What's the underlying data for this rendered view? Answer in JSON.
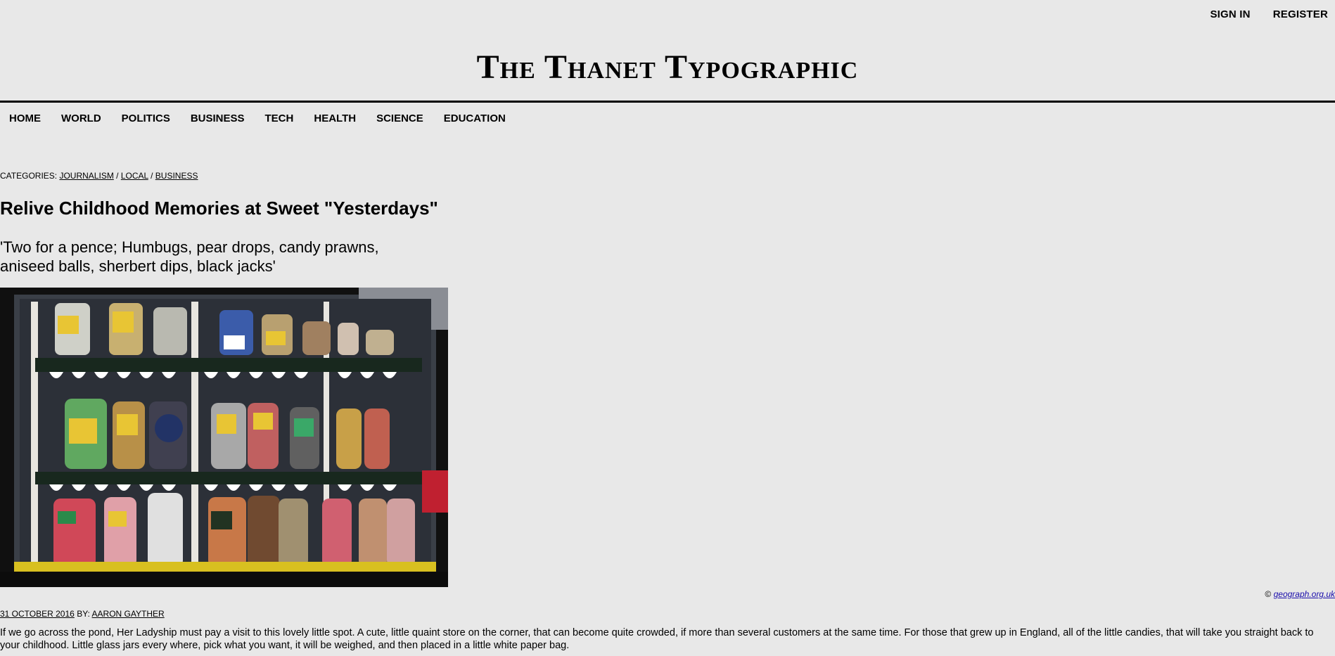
{
  "header": {
    "sign_in": "SIGN IN",
    "register": "REGISTER",
    "masthead": "The Thanet Typographic"
  },
  "nav": {
    "items": [
      "HOME",
      "WORLD",
      "POLITICS",
      "BUSINESS",
      "TECH",
      "HEALTH",
      "SCIENCE",
      "EDUCATION"
    ]
  },
  "article": {
    "categories_label": "CATEGORIES:",
    "categories": [
      "JOURNALISM",
      "LOCAL",
      "BUSINESS"
    ],
    "category_separator": "/",
    "headline": "Relive Childhood Memories at Sweet \"Yesterdays\"",
    "dek": "'Two for a pence; Humbugs, pear drops, candy prawns, aniseed balls, sherbert dips, black jacks'",
    "image_credit_prefix": "©",
    "image_credit_link": "geograph.org.uk",
    "date": "31 OCTOBER 2016",
    "by_label": "BY:",
    "author": "AARON GAYTHER",
    "body": "If we go across the pond, Her Ladyship must pay a visit to this lovely little spot. A cute, little quaint store on the corner, that can become quite crowded, if more than several customers at the same time. For those that grew up in England, all of the little candies, that will take you straight back to your childhood. Little glass jars every where, pick what you want, it will be weighed, and then placed in a little white paper bag."
  },
  "colors": {
    "background": "#e8e8e8",
    "text": "#000000",
    "link_credit": "#1a0dab"
  }
}
